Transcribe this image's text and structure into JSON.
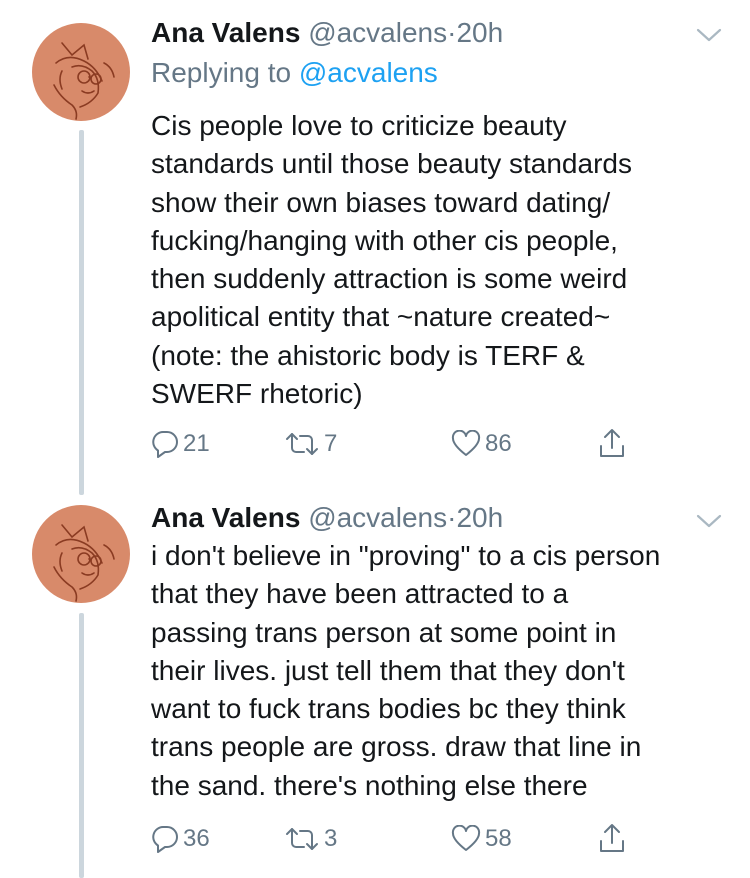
{
  "tweets": [
    {
      "author_name": "Ana Valens",
      "handle": "@acvalens",
      "separator": "·",
      "time": "20h",
      "replying_prefix": "Replying to",
      "replying_to": "@acvalens",
      "body_lines": [
        "Cis people love to criticize beauty",
        "standards until those beauty standards",
        "show their own biases toward dating/",
        "fucking/hanging with other cis people,",
        "then suddenly attraction is some weird",
        "apolitical entity that ~nature created~",
        "(note: the ahistoric body is TERF &",
        "SWERF rhetoric)"
      ],
      "replies": "21",
      "retweets": "7",
      "likes": "86"
    },
    {
      "author_name": "Ana Valens",
      "handle": "@acvalens",
      "separator": "·",
      "time": "20h",
      "body_lines": [
        "i don't believe in \"proving\" to a cis person",
        "that they have been attracted to a",
        "passing trans person at some point in",
        "their lives. just tell them that they don't",
        "want to fuck trans bodies bc they think",
        "trans people are gross. draw that line in",
        "the sand. there's nothing else there"
      ],
      "replies": "36",
      "retweets": "3",
      "likes": "58"
    }
  ],
  "icons": {
    "reply": "reply-icon",
    "retweet": "retweet-icon",
    "like": "heart-icon",
    "share": "share-icon",
    "menu": "chevron-down-icon"
  },
  "colors": {
    "text": "#14171a",
    "secondary": "#657786",
    "link": "#1da1f2",
    "avatar_bg": "#d88a6a",
    "thread_line": "#ccd6dd"
  }
}
